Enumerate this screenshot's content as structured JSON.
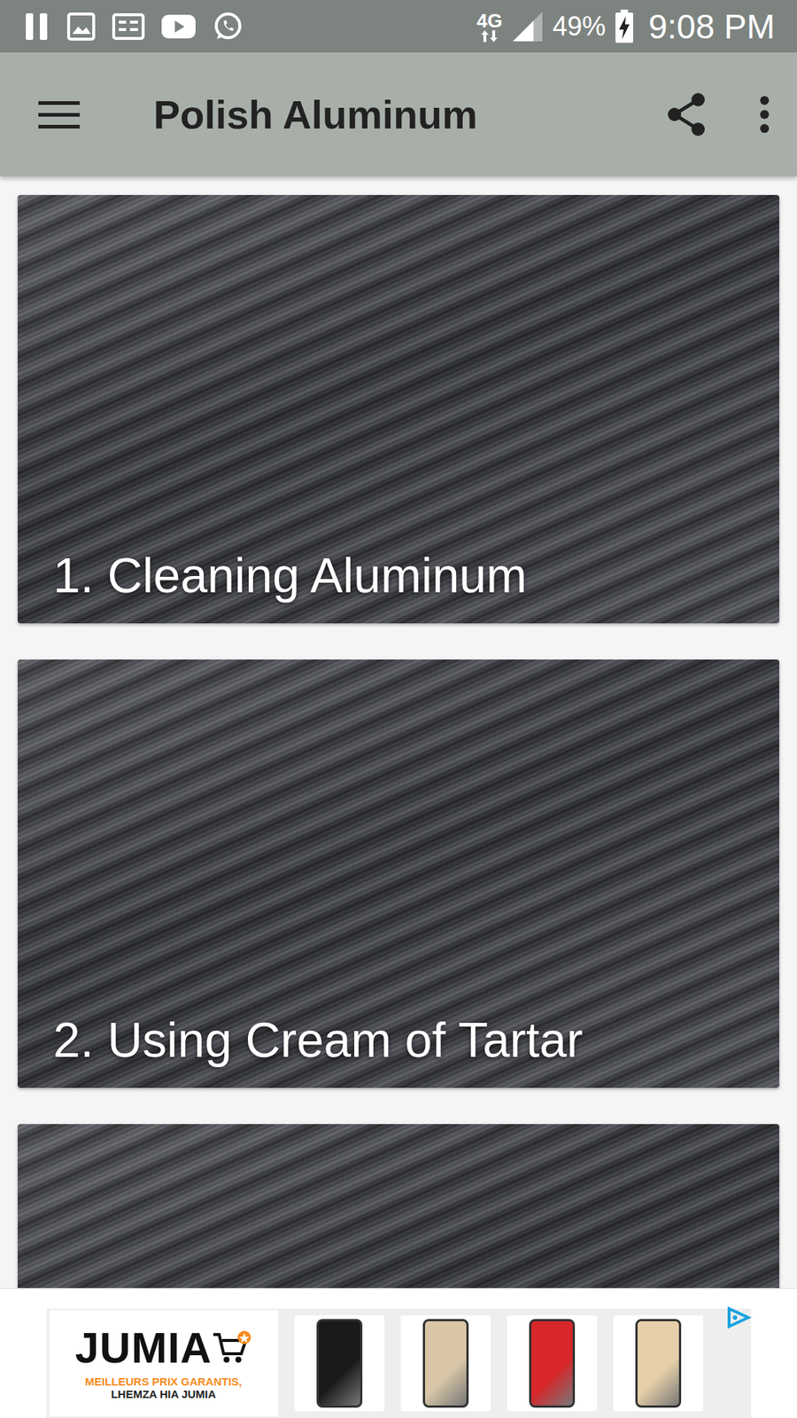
{
  "status_bar": {
    "network": "4G",
    "battery": "49%",
    "time": "9:08 PM"
  },
  "app_bar": {
    "title": "Polish Aluminum"
  },
  "cards": [
    {
      "title": "1. Cleaning Aluminum"
    },
    {
      "title": "2. Using Cream of Tartar"
    },
    {
      "title": null
    }
  ],
  "ad": {
    "brand": "JUMIA",
    "tagline": "MEILLEURS PRIX GARANTIS,",
    "slogan": "LHEMZA HIA JUMIA",
    "products": [
      {
        "color": "#1a1a1a"
      },
      {
        "color": "#d8c6a6"
      },
      {
        "color": "#d8262b"
      },
      {
        "color": "#e6cfa8"
      }
    ]
  }
}
